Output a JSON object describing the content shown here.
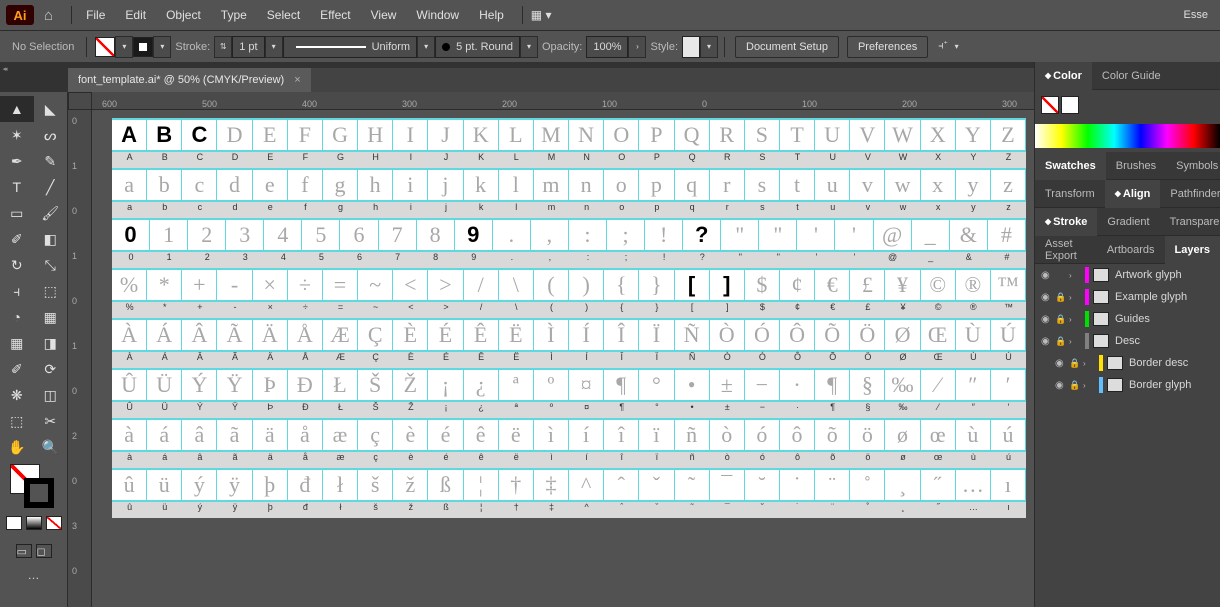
{
  "menubar": {
    "logo": "Ai",
    "items": [
      "File",
      "Edit",
      "Object",
      "Type",
      "Select",
      "Effect",
      "View",
      "Window",
      "Help"
    ],
    "workspace": "Esse"
  },
  "controlbar": {
    "selection": "No Selection",
    "stroke_label": "Stroke:",
    "stroke_pt": "1 pt",
    "uniform": "Uniform",
    "width_profile": "5 pt. Round",
    "opacity_label": "Opacity:",
    "opacity_val": "100%",
    "style_label": "Style:",
    "doc_setup": "Document Setup",
    "prefs": "Preferences"
  },
  "tab": {
    "title": "font_template.ai* @ 50% (CMYK/Preview)"
  },
  "ruler_h": [
    "600",
    "500",
    "400",
    "300",
    "200",
    "100",
    "0",
    "100",
    "200",
    "300"
  ],
  "ruler_v": [
    "0",
    "1",
    "0",
    "1",
    "0",
    "1",
    "0",
    "2",
    "0",
    "3",
    "0"
  ],
  "rows": [
    {
      "glyphs": [
        "A",
        "B",
        "C",
        "D",
        "E",
        "F",
        "G",
        "H",
        "I",
        "J",
        "K",
        "L",
        "M",
        "N",
        "O",
        "P",
        "Q",
        "R",
        "S",
        "T",
        "U",
        "V",
        "W",
        "X",
        "Y",
        "Z"
      ],
      "drawn": [
        0,
        1,
        2
      ]
    },
    {
      "glyphs": [
        "a",
        "b",
        "c",
        "d",
        "e",
        "f",
        "g",
        "h",
        "i",
        "j",
        "k",
        "l",
        "m",
        "n",
        "o",
        "p",
        "q",
        "r",
        "s",
        "t",
        "u",
        "v",
        "w",
        "x",
        "y",
        "z"
      ],
      "drawn": []
    },
    {
      "glyphs": [
        "0",
        "1",
        "2",
        "3",
        "4",
        "5",
        "6",
        "7",
        "8",
        "9",
        ".",
        ",",
        ":",
        ";",
        "!",
        "?",
        "\"",
        "\"",
        "'",
        "'",
        "@",
        "_",
        "&",
        "#"
      ],
      "drawn": [
        0,
        9,
        15
      ]
    },
    {
      "glyphs": [
        "%",
        "*",
        "+",
        "-",
        "×",
        "÷",
        "=",
        "~",
        "<",
        ">",
        "/",
        "\\",
        "(",
        ")",
        "{",
        "}",
        "[",
        "]",
        "$",
        "¢",
        "€",
        "£",
        "¥",
        "©",
        "®",
        "™"
      ],
      "drawn": [
        16,
        17
      ]
    },
    {
      "glyphs": [
        "À",
        "Á",
        "Â",
        "Ã",
        "Ä",
        "Å",
        "Æ",
        "Ç",
        "È",
        "É",
        "Ê",
        "Ë",
        "Ì",
        "Í",
        "Î",
        "Ï",
        "Ñ",
        "Ò",
        "Ó",
        "Ô",
        "Õ",
        "Ö",
        "Ø",
        "Œ",
        "Ù",
        "Ú"
      ],
      "drawn": []
    },
    {
      "glyphs": [
        "Û",
        "Ü",
        "Ý",
        "Ÿ",
        "Þ",
        "Đ",
        "Ł",
        "Š",
        "Ž",
        "¡",
        "¿",
        "ª",
        "º",
        "¤",
        "¶",
        "°",
        "•",
        "±",
        "−",
        "·",
        "¶",
        "§",
        "‰",
        "⁄",
        "″",
        "′"
      ],
      "drawn": []
    },
    {
      "glyphs": [
        "à",
        "á",
        "â",
        "ã",
        "ä",
        "å",
        "æ",
        "ç",
        "è",
        "é",
        "ê",
        "ë",
        "ì",
        "í",
        "î",
        "ï",
        "ñ",
        "ò",
        "ó",
        "ô",
        "õ",
        "ö",
        "ø",
        "œ",
        "ù",
        "ú"
      ],
      "drawn": []
    },
    {
      "glyphs": [
        "û",
        "ü",
        "ý",
        "ÿ",
        "þ",
        "đ",
        "ł",
        "š",
        "ž",
        "ß",
        "¦",
        "†",
        "‡",
        "^",
        "ˆ",
        "ˇ",
        "˜",
        "¯",
        "˘",
        "˙",
        "¨",
        "˚",
        "¸",
        "˝",
        "…",
        "ı"
      ],
      "drawn": []
    }
  ],
  "panels": {
    "color": {
      "tabs": [
        "Color",
        "Color Guide"
      ],
      "active": 0
    },
    "swatches": {
      "tabs": [
        "Swatches",
        "Brushes",
        "Symbols"
      ],
      "active": 0
    },
    "align": {
      "tabs": [
        "Transform",
        "Align",
        "Pathfinder"
      ],
      "active": 1
    },
    "stroke": {
      "tabs": [
        "Stroke",
        "Gradient",
        "Transparency"
      ],
      "active": 0
    },
    "layers_tabs": {
      "tabs": [
        "Asset Export",
        "Artboards",
        "Layers"
      ],
      "active": 2
    },
    "layers": [
      {
        "name": "Artwork glyph",
        "color": "#ff00ff",
        "locked": false,
        "sub": false
      },
      {
        "name": "Example glyph",
        "color": "#ff00ff",
        "locked": true,
        "sub": false
      },
      {
        "name": "Guides",
        "color": "#00e000",
        "locked": true,
        "sub": false
      },
      {
        "name": "Desc",
        "color": "#808080",
        "locked": true,
        "sub": false
      },
      {
        "name": "Border desc",
        "color": "#ffe000",
        "locked": true,
        "sub": true
      },
      {
        "name": "Border glyph",
        "color": "#60c0ff",
        "locked": true,
        "sub": true
      }
    ]
  }
}
